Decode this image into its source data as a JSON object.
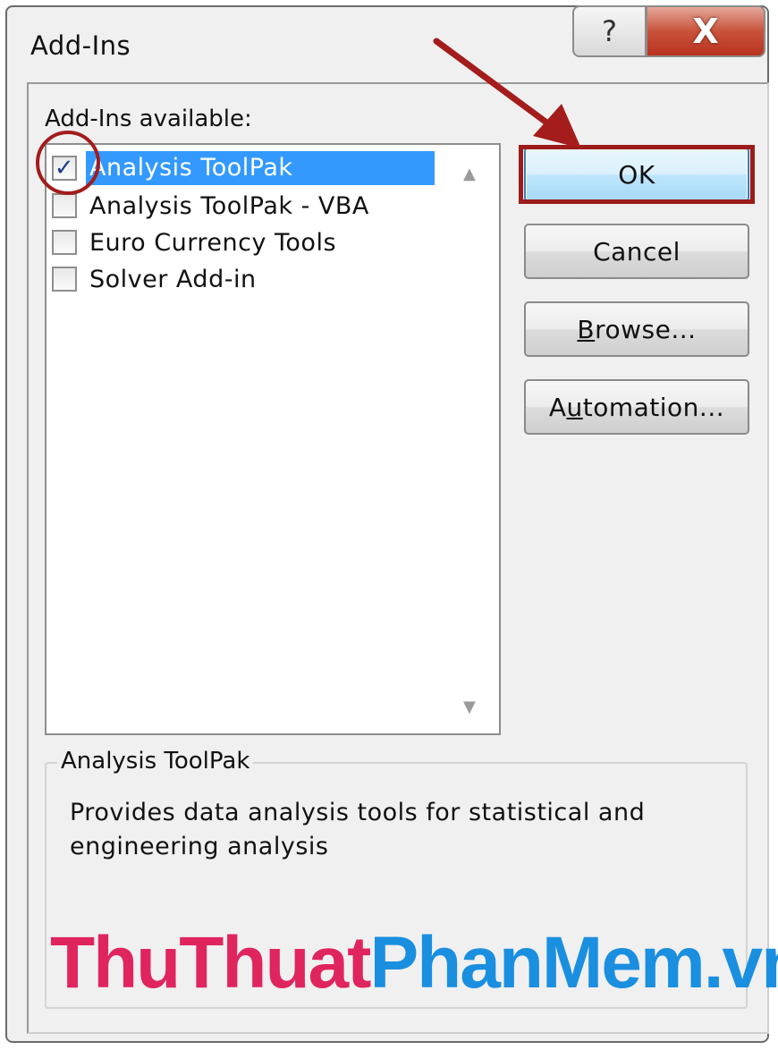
{
  "window": {
    "title": "Add-Ins",
    "help_label": "?",
    "close_label": "X"
  },
  "addins": {
    "label": "Add-Ins available:",
    "items": [
      {
        "label": "Analysis ToolPak",
        "checked": true,
        "selected": true
      },
      {
        "label": "Analysis ToolPak - VBA",
        "checked": false,
        "selected": false
      },
      {
        "label": "Euro Currency Tools",
        "checked": false,
        "selected": false
      },
      {
        "label": "Solver Add-in",
        "checked": false,
        "selected": false
      }
    ]
  },
  "buttons": {
    "ok": "OK",
    "cancel": "Cancel",
    "browse_underline": "B",
    "browse_rest": "rowse...",
    "automation_pre": "A",
    "automation_underline": "u",
    "automation_rest": "tomation..."
  },
  "description": {
    "group_title": "Analysis ToolPak",
    "text": "Provides data analysis tools for statistical and engineering analysis"
  },
  "watermark": {
    "red_part": "ThuThuat",
    "blue_part": "PhanMem.vn"
  },
  "colors": {
    "selection": "#3399ff",
    "annotation_red": "#9d1b1b",
    "watermark_red": "#e0245e",
    "watermark_blue": "#1a8fe0"
  },
  "icons": {
    "checkmark": "checkmark-icon",
    "scroll_up": "scroll-up-icon",
    "scroll_down": "scroll-down-icon",
    "help": "help-icon",
    "close": "close-icon"
  }
}
